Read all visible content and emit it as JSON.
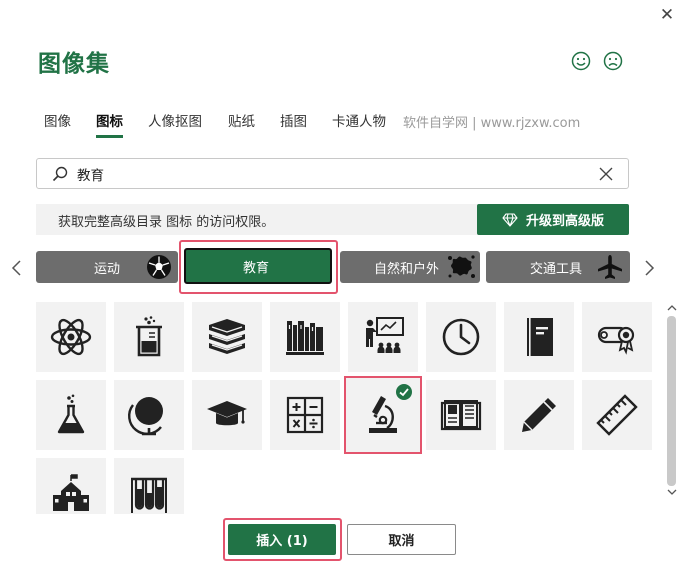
{
  "dialog": {
    "title": "图像集",
    "close_label": "✕"
  },
  "tabs": [
    {
      "label": "图像",
      "active": false
    },
    {
      "label": "图标",
      "active": true
    },
    {
      "label": "人像抠图",
      "active": false
    },
    {
      "label": "贴纸",
      "active": false
    },
    {
      "label": "插图",
      "active": false
    },
    {
      "label": "卡通人物",
      "active": false
    }
  ],
  "watermark": "软件自学网 | www.rjzxw.com",
  "search": {
    "value": "教育",
    "placeholder": ""
  },
  "banner": {
    "text": "获取完整高级目录 图标 的访问权限。",
    "upgrade_label": "升级到高级版"
  },
  "categories": [
    {
      "label": "运动",
      "icon": "soccer-ball-icon",
      "active": false
    },
    {
      "label": "教育",
      "icon": "",
      "active": true
    },
    {
      "label": "自然和户外",
      "icon": "splash-icon",
      "active": false
    },
    {
      "label": "交通工具",
      "icon": "airplane-icon",
      "active": false
    }
  ],
  "icons": [
    {
      "name": "atom-icon",
      "selected": false
    },
    {
      "name": "beaker-icon",
      "selected": false
    },
    {
      "name": "stacked-books-icon",
      "selected": false
    },
    {
      "name": "bookshelf-icon",
      "selected": false
    },
    {
      "name": "classroom-teacher-icon",
      "selected": false
    },
    {
      "name": "clock-icon",
      "selected": false
    },
    {
      "name": "notebook-icon",
      "selected": false
    },
    {
      "name": "diploma-icon",
      "selected": false
    },
    {
      "name": "flask-icon",
      "selected": false
    },
    {
      "name": "globe-icon",
      "selected": false
    },
    {
      "name": "graduation-cap-icon",
      "selected": false
    },
    {
      "name": "calculator-icon",
      "selected": false
    },
    {
      "name": "microscope-icon",
      "selected": true
    },
    {
      "name": "open-book-icon",
      "selected": false
    },
    {
      "name": "pencil-icon",
      "selected": false
    },
    {
      "name": "ruler-icon",
      "selected": false
    },
    {
      "name": "school-icon",
      "selected": false
    },
    {
      "name": "test-tubes-icon",
      "selected": false
    }
  ],
  "buttons": {
    "insert_label": "插入 (1)",
    "cancel_label": "取消"
  },
  "colors": {
    "accent": "#217346",
    "highlight": "#e3546d",
    "category_bg": "#6d6d6d",
    "tile_bg": "#f2f2f2"
  }
}
